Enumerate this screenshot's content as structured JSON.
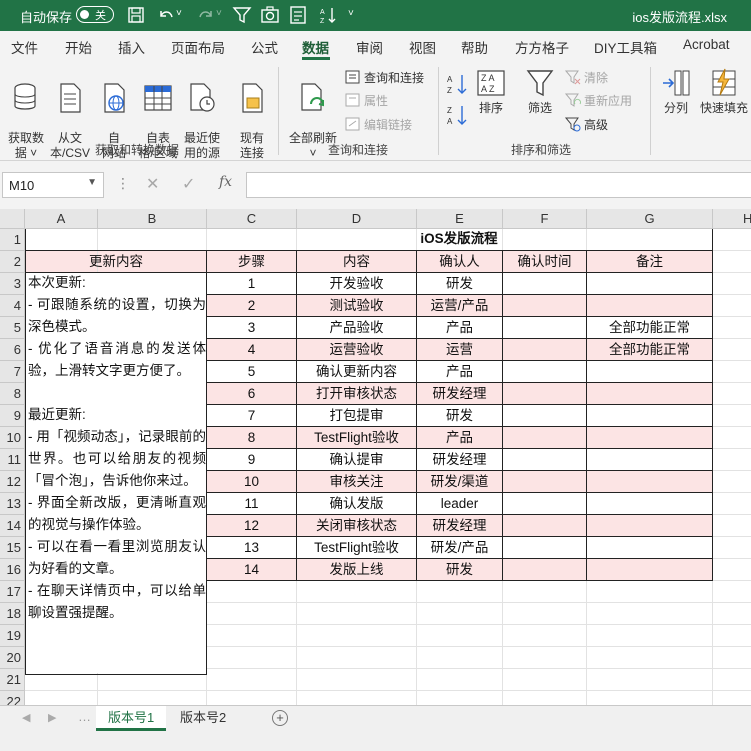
{
  "titlebar": {
    "autosave_label": "自动保存",
    "autosave_state": "关",
    "filename": "ios发版流程.xlsx",
    "bg_color": "#217346"
  },
  "tabs": [
    "文件",
    "开始",
    "插入",
    "页面布局",
    "公式",
    "数据",
    "审阅",
    "视图",
    "帮助",
    "方方格子",
    "DIY工具箱",
    "Acrobat"
  ],
  "active_tab": "数据",
  "ribbon": {
    "get_data": "获取数\n据 ˅",
    "from_csv": "从文\n本/CSV",
    "from_web": "自\n网站",
    "from_table": "自表\n格/区域",
    "recent_sources": "最近使\n用的源",
    "existing_conn": "现有\n连接",
    "group1_label": "获取和转换数据",
    "refresh_all": "全部刷新\n˅",
    "queries_conn": "查询和连接",
    "properties": "属性",
    "edit_links": "编辑链接",
    "group2_label": "查询和连接",
    "sort": "排序",
    "filter": "筛选",
    "clear": "清除",
    "reapply": "重新应用",
    "advanced": "高级",
    "group3_label": "排序和筛选",
    "split": "分列",
    "flash_fill": "快速填充"
  },
  "formula_bar": {
    "name_box": "M10",
    "formula": ""
  },
  "columns": [
    "A",
    "B",
    "C",
    "D",
    "E",
    "F",
    "G",
    "H"
  ],
  "rows": [
    "1",
    "2",
    "3",
    "4",
    "5",
    "6",
    "7",
    "8",
    "9",
    "10",
    "11",
    "12",
    "13",
    "14",
    "15",
    "16",
    "17",
    "18",
    "19",
    "20",
    "21",
    "22"
  ],
  "sheet": {
    "title": "iOS发版流程",
    "update_header": "更新内容",
    "headers": [
      "步骤",
      "内容",
      "确认人",
      "确认时间",
      "备注"
    ],
    "steps": [
      {
        "step": "1",
        "content": "开发验收",
        "owner": "研发",
        "time": "",
        "note": ""
      },
      {
        "step": "2",
        "content": "测试验收",
        "owner": "运营/产品",
        "time": "",
        "note": ""
      },
      {
        "step": "3",
        "content": "产品验收",
        "owner": "产品",
        "time": "",
        "note": "全部功能正常"
      },
      {
        "step": "4",
        "content": "运营验收",
        "owner": "运营",
        "time": "",
        "note": "全部功能正常"
      },
      {
        "step": "5",
        "content": "确认更新内容",
        "owner": "产品",
        "time": "",
        "note": ""
      },
      {
        "step": "6",
        "content": "打开审核状态",
        "owner": "研发经理",
        "time": "",
        "note": ""
      },
      {
        "step": "7",
        "content": "打包提审",
        "owner": "研发",
        "time": "",
        "note": ""
      },
      {
        "step": "8",
        "content": "TestFlight验收",
        "owner": "产品",
        "time": "",
        "note": ""
      },
      {
        "step": "9",
        "content": "确认提审",
        "owner": "研发经理",
        "time": "",
        "note": ""
      },
      {
        "step": "10",
        "content": "审核关注",
        "owner": "研发/渠道",
        "time": "",
        "note": ""
      },
      {
        "step": "11",
        "content": "确认发版",
        "owner": "leader",
        "time": "",
        "note": ""
      },
      {
        "step": "12",
        "content": "关闭审核状态",
        "owner": "研发经理",
        "time": "",
        "note": ""
      },
      {
        "step": "13",
        "content": "TestFlight验收",
        "owner": "研发/产品",
        "time": "",
        "note": ""
      },
      {
        "step": "14",
        "content": "发版上线",
        "owner": "研发",
        "time": "",
        "note": ""
      }
    ],
    "notes": "本次更新:\n- 可跟随系统的设置，切换为深色模式。\n- 优化了语音消息的发送体验，上滑转文字更方便了。\n\n最近更新:\n- 用「视频动态」，记录眼前的世界。也可以给朋友的视频「冒个泡」，告诉他你来过。\n- 界面全新改版，更清晰直观的视觉与操作体验。\n- 可以在看一看里浏览朋友认为好看的文章。\n- 在聊天详情页中，可以给单聊设置强提醒。",
    "pink_color": "#fce4e4"
  },
  "sheet_tabs": [
    "版本号1",
    "版本号2"
  ],
  "active_sheet": "版本号1"
}
